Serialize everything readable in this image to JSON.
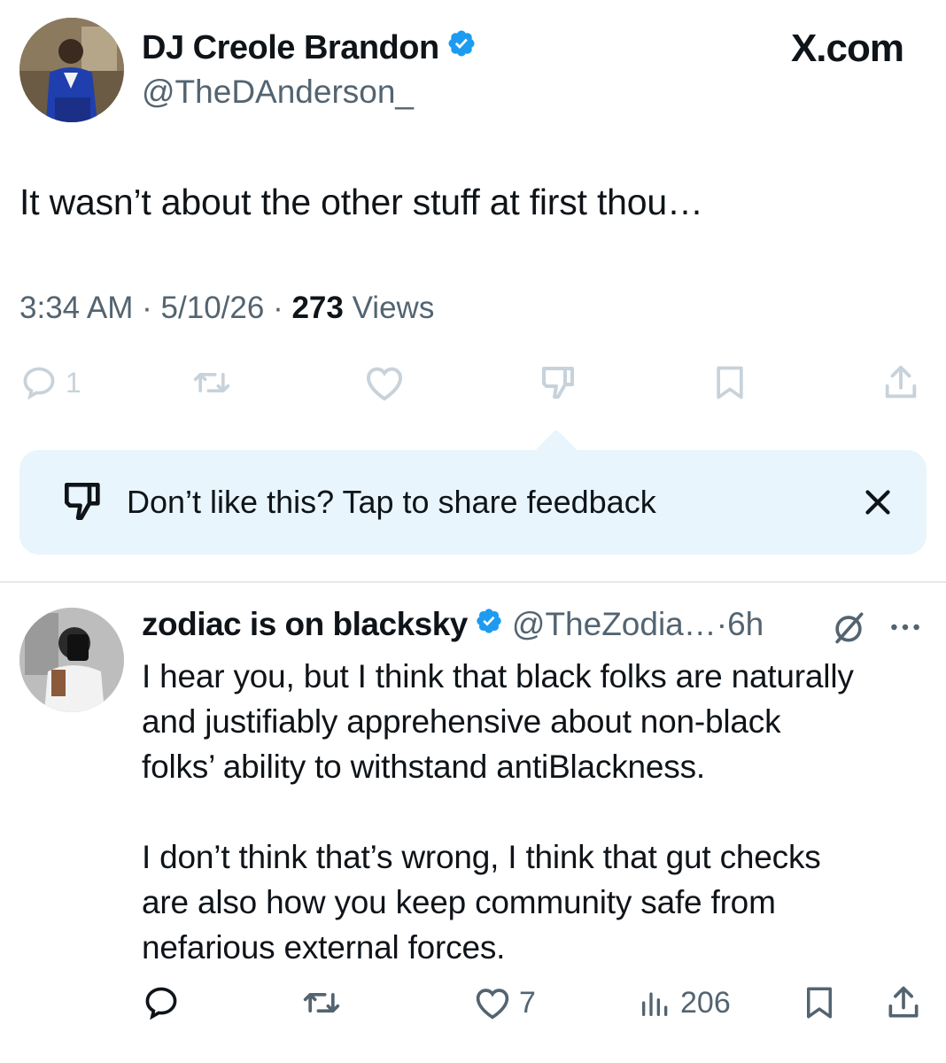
{
  "header": {
    "display_name": "DJ Creole Brandon",
    "handle": "@TheDAnderson_",
    "brand": "X.com"
  },
  "tweet": {
    "text": "It wasn’t about the other stuff at first thou…",
    "time": "3:34 AM",
    "date": "5/10/26",
    "views_count": "273",
    "views_label": "Views",
    "reply_count": "1"
  },
  "feedback": {
    "text": "Don’t like this? Tap to share feedback"
  },
  "reply": {
    "display_name": "zodiac is on blacksky",
    "handle": "@TheZodia…",
    "time": "6h",
    "paragraph_1": "I hear you, but I think that black folks are naturally\nand justifiably apprehensive about non-black\nfolks’ ability to withstand antiBlackness.",
    "paragraph_2": "I don’t think that’s wrong, I think that gut checks\nare also how you keep community safe from\nnefarious external forces.",
    "like_count": "7",
    "view_count": "206"
  },
  "colors": {
    "verified": "#1d9bf0",
    "secondary_text": "#536471",
    "muted_icon": "#c8d2da",
    "feedback_bg": "#e8f5fd"
  },
  "icons": [
    "verified-badge-icon",
    "reply-icon",
    "retweet-icon",
    "like-icon",
    "dislike-icon",
    "bookmark-icon",
    "share-icon",
    "close-icon",
    "grok-icon",
    "more-icon",
    "views-icon"
  ]
}
